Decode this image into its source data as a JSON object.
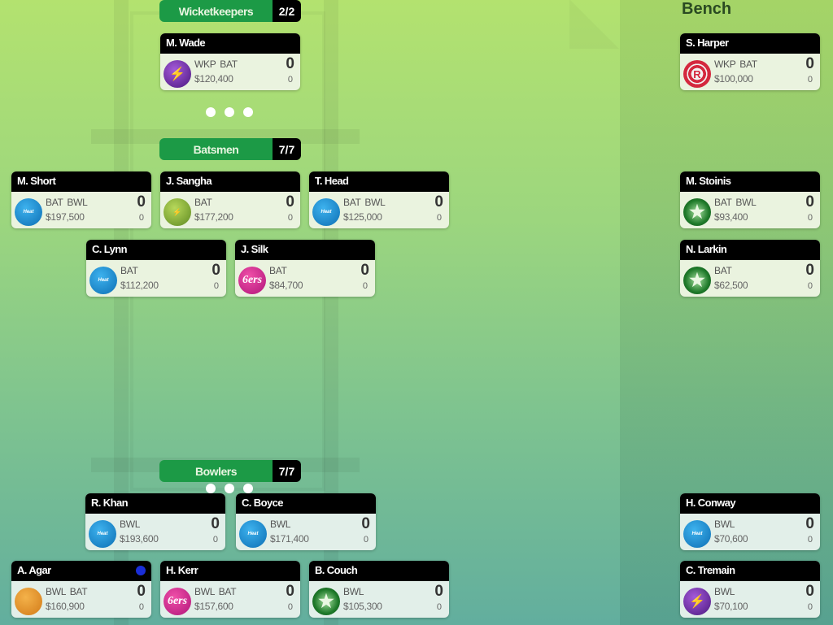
{
  "bench": {
    "title": "Bench",
    "players": [
      {
        "name": "S. Harper",
        "team_icon": "renegades-logo-icon",
        "logo_glyph": "R",
        "positions": "WKP BAT",
        "price": "$100,000",
        "points": "0",
        "sub_points": "0"
      },
      {
        "name": "M. Stoinis",
        "team_icon": "stars-logo-icon",
        "logo_glyph": "★",
        "positions": "BAT  BWL",
        "price": "$93,400",
        "points": "0",
        "sub_points": "0"
      },
      {
        "name": "N. Larkin",
        "team_icon": "stars-logo-icon",
        "logo_glyph": "★",
        "positions": "BAT",
        "price": "$62,500",
        "points": "0",
        "sub_points": "0"
      },
      {
        "name": "H. Conway",
        "team_icon": "heat-logo-icon",
        "logo_glyph": "Heat",
        "positions": "BWL",
        "price": "$70,600",
        "points": "0",
        "sub_points": "0"
      },
      {
        "name": "C. Tremain",
        "team_icon": "strikers-logo-icon",
        "logo_glyph": "⚡",
        "positions": "BWL",
        "price": "$70,100",
        "points": "0",
        "sub_points": "0"
      }
    ]
  },
  "sections": {
    "wicketkeepers": {
      "label": "Wicketkeepers",
      "count": "2/2"
    },
    "batsmen": {
      "label": "Batsmen",
      "count": "7/7"
    },
    "bowlers": {
      "label": "Bowlers",
      "count": "7/7"
    }
  },
  "wicketkeepers": [
    {
      "name": "M. Wade",
      "team_icon": "strikers-logo-icon",
      "logo_glyph": "⚡",
      "positions": "WKP BAT",
      "price": "$120,400",
      "points": "0",
      "sub_points": "0"
    }
  ],
  "batsmen": [
    {
      "name": "M. Short",
      "team_icon": "heat-logo-icon",
      "logo_glyph": "Heat",
      "positions": "BAT  BWL",
      "price": "$197,500",
      "points": "0",
      "sub_points": "0"
    },
    {
      "name": "J. Sangha",
      "team_icon": "thunder-logo-icon",
      "logo_glyph": "⚡",
      "positions": "BAT",
      "price": "$177,200",
      "points": "0",
      "sub_points": "0"
    },
    {
      "name": "T. Head",
      "team_icon": "heat-logo-icon",
      "logo_glyph": "Heat",
      "positions": "BAT  BWL",
      "price": "$125,000",
      "points": "0",
      "sub_points": "0"
    },
    {
      "name": "C. Lynn",
      "team_icon": "heat-logo-icon",
      "logo_glyph": "Heat",
      "positions": "BAT",
      "price": "$112,200",
      "points": "0",
      "sub_points": "0"
    },
    {
      "name": "J. Silk",
      "team_icon": "sixers-logo-icon",
      "logo_glyph": "6ers",
      "positions": "BAT",
      "price": "$84,700",
      "points": "0",
      "sub_points": "0"
    }
  ],
  "bowlers": [
    {
      "name": "R. Khan",
      "team_icon": "heat-logo-icon",
      "logo_glyph": "Heat",
      "positions": "BWL",
      "price": "$193,600",
      "points": "0",
      "sub_points": "0"
    },
    {
      "name": "C. Boyce",
      "team_icon": "heat-logo-icon",
      "logo_glyph": "Heat",
      "positions": "BWL",
      "price": "$171,400",
      "points": "0",
      "sub_points": "0"
    },
    {
      "name": "A. Agar",
      "team_icon": "scorchers-logo-icon",
      "logo_glyph": "",
      "positions": "BWL BAT",
      "price": "$160,900",
      "points": "0",
      "sub_points": "0",
      "flag": "blue-dot"
    },
    {
      "name": "H. Kerr",
      "team_icon": "sixers-logo-icon",
      "logo_glyph": "6ers",
      "positions": "BWL BAT",
      "price": "$157,600",
      "points": "0",
      "sub_points": "0"
    },
    {
      "name": "B. Couch",
      "team_icon": "stars-logo-icon",
      "logo_glyph": "★",
      "positions": "BWL",
      "price": "$105,300",
      "points": "0",
      "sub_points": "0"
    }
  ],
  "colors": {
    "section_green": "#1c9a46",
    "card_header": "#000000",
    "flag_blue": "#1a2ed8"
  }
}
